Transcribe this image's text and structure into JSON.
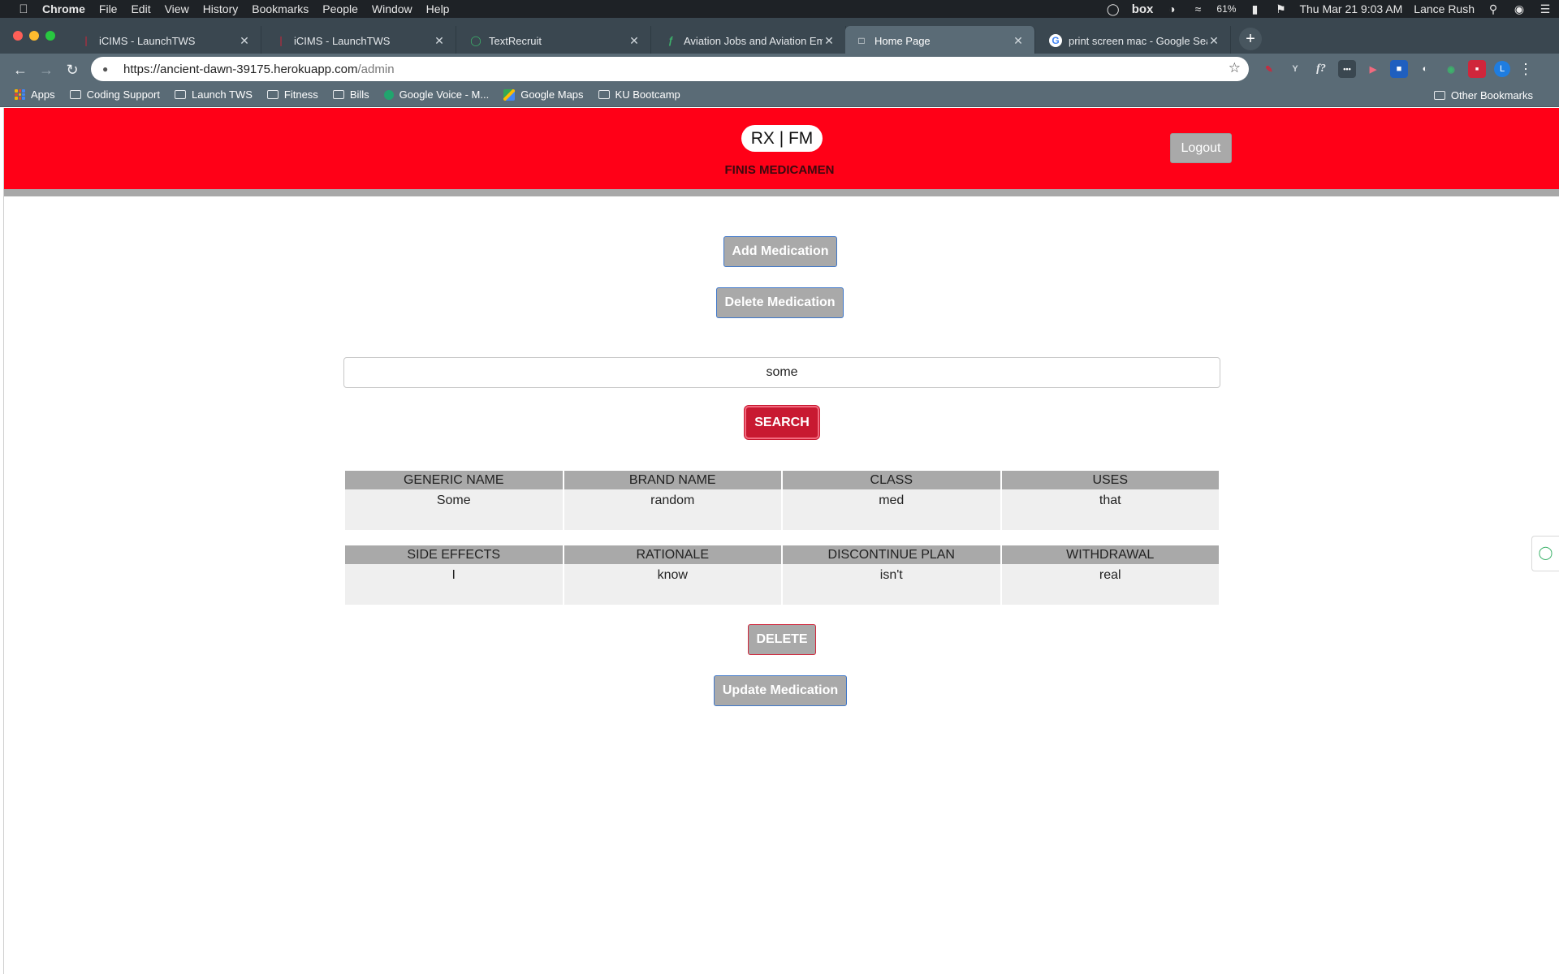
{
  "menubar": {
    "items": [
      "Chrome",
      "File",
      "Edit",
      "View",
      "History",
      "Bookmarks",
      "People",
      "Window",
      "Help"
    ],
    "box_label": "box",
    "battery": "61%",
    "datetime": "Thu Mar 21  9:03 AM",
    "user": "Lance Rush"
  },
  "tabs": [
    {
      "title": "iCIMS - LaunchTWS",
      "active": false
    },
    {
      "title": "iCIMS - LaunchTWS",
      "active": false
    },
    {
      "title": "TextRecruit",
      "active": false
    },
    {
      "title": "Aviation Jobs and Aviation Emp",
      "active": false
    },
    {
      "title": "Home Page",
      "active": true
    },
    {
      "title": "print screen mac - Google Sea",
      "active": false
    }
  ],
  "toolbar": {
    "url_host": "https://ancient-dawn-39175.herokuapp.com",
    "url_path": "/admin",
    "profile_initial": "L",
    "ext_text": {
      "y": "Y",
      "f": "f?"
    }
  },
  "bookmarks": {
    "items": [
      "Apps",
      "Coding Support",
      "Launch TWS",
      "Fitness",
      "Bills",
      "Google Voice - M...",
      "Google Maps",
      "KU Bootcamp"
    ],
    "other": "Other Bookmarks"
  },
  "header": {
    "brand": "RX | FM",
    "subtitle": "FINIS MEDICAMEN",
    "logout_label": "Logout"
  },
  "actions": {
    "add_label": "Add Medication",
    "delete_med_label": "Delete Medication",
    "search_value": "some",
    "search_label": "SEARCH",
    "delete_label": "DELETE",
    "update_label": "Update Medication"
  },
  "table1": {
    "headers": [
      "GENERIC NAME",
      "BRAND NAME",
      "CLASS",
      "USES"
    ],
    "row": [
      "Some",
      "random",
      "med",
      "that"
    ]
  },
  "table2": {
    "headers": [
      "SIDE EFFECTS",
      "RATIONALE",
      "DISCONTINUE PLAN",
      "WITHDRAWAL"
    ],
    "row": [
      "I",
      "know",
      "isn't",
      "real"
    ]
  },
  "colors": {
    "header_red": "#ff0017",
    "search_red": "#c81931",
    "button_gray": "#a9a9a9",
    "button_border_blue": "#3f77c9"
  }
}
